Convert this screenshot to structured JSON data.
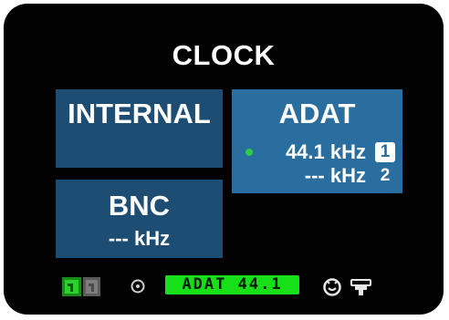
{
  "title": "CLOCK",
  "sources": {
    "internal": {
      "label": "INTERNAL"
    },
    "adat": {
      "label": "ADAT",
      "selected": true,
      "rows": [
        {
          "rate": "44.1 kHz",
          "port": "1",
          "locked": true
        },
        {
          "rate": "--- kHz",
          "port": "2",
          "locked": false
        }
      ]
    },
    "bnc": {
      "label": "BNC",
      "rate": "--- kHz"
    }
  },
  "status_bar": {
    "clock_status": "ADAT 44.1",
    "icons": [
      "sync-indicator-icon",
      "sync-indicator-inactive-icon",
      "reference-target-icon",
      "meter-dial-icon",
      "usb-connector-icon"
    ]
  },
  "colors": {
    "background": "#020202",
    "tile": "#1d4d72",
    "tile_selected": "#2a6e9f",
    "lock_green": "#2ecc40",
    "status_badge": "#18e018"
  }
}
